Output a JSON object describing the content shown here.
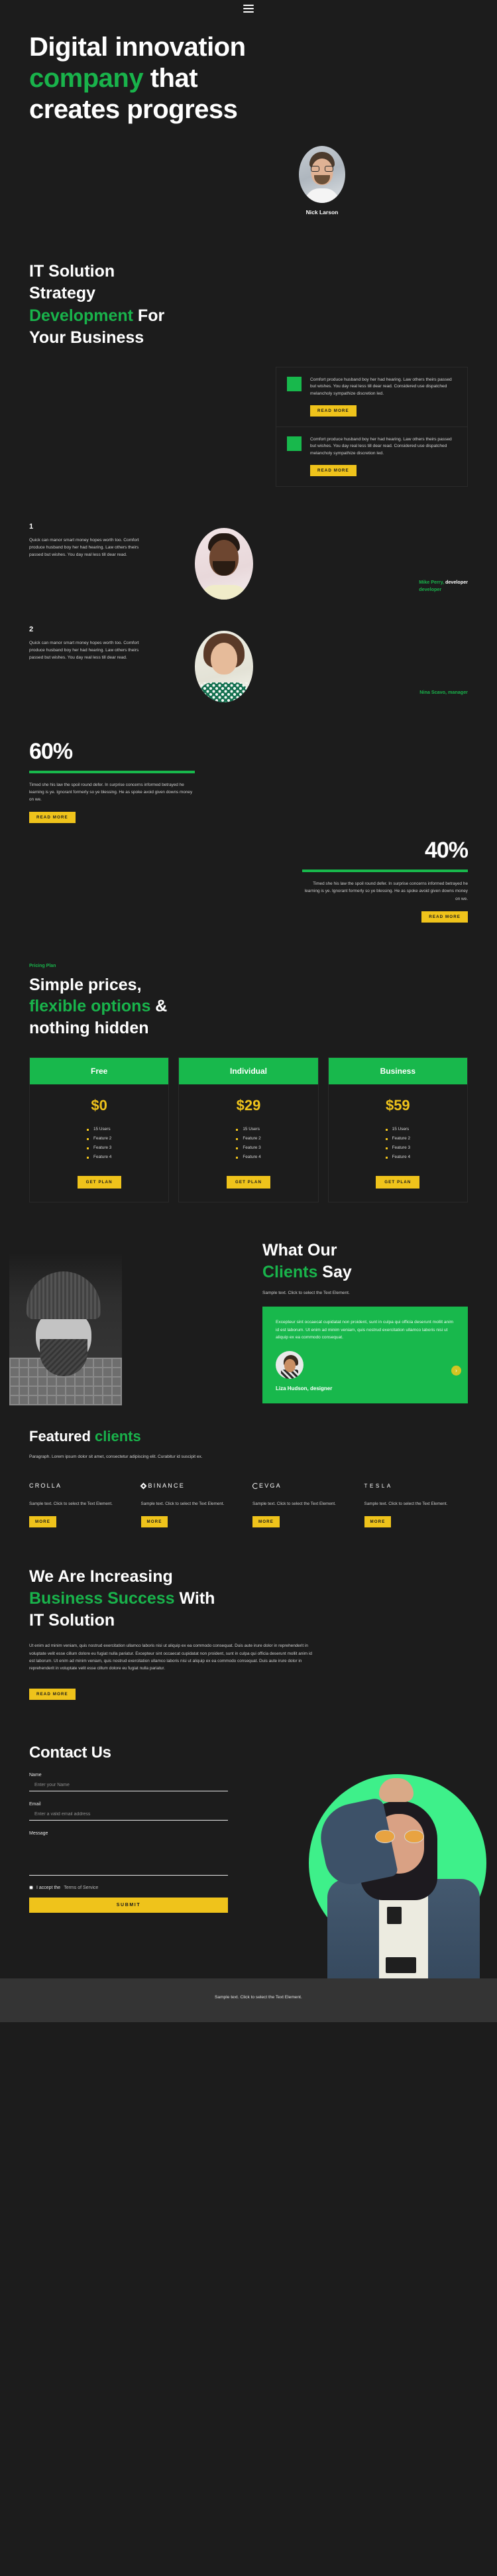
{
  "header": {
    "menu_icon": "hamburger-menu-icon"
  },
  "hero": {
    "title_line1": "Digital innovation",
    "title_accent": "company",
    "title_line2_rest": " that",
    "title_line3": "creates progress",
    "person_name": "Nick Larson"
  },
  "it_solution": {
    "h_line1": "IT Solution",
    "h_line2": "Strategy",
    "h_accent": "Development",
    "h_line3_rest": " For",
    "h_line4": "Your Business",
    "cards": [
      {
        "text": "Comfort produce husband boy her had hearing. Law others theirs passed but wishes. You day real less till dear read. Considered use dispatched melancholy sympathize discretion led.",
        "button": "READ MORE"
      },
      {
        "text": "Comfort produce husband boy her had hearing. Law others theirs passed but wishes. You day real less till dear read. Considered use dispatched melancholy sympathize discretion led.",
        "button": "READ MORE"
      }
    ]
  },
  "team": [
    {
      "number": "1",
      "text": "Quick can manor smart money hopes worth too. Comfort produce husband boy her had hearing. Law others theirs passed but wishes. You day real less till dear read.",
      "name": "Mike Perry,",
      "role": " developer",
      "role2": "developer"
    },
    {
      "number": "2",
      "text": "Quick can manor smart money hopes worth too. Comfort produce husband boy her had hearing. Law others theirs passed but wishes. You day real less till dear read.",
      "name": "Nina Scavo, manager",
      "role": "",
      "role2": ""
    }
  ],
  "stats": [
    {
      "value": "60%",
      "text": "Timed she his law the spoil round defer. In surprise concerns informed betrayed he learning is ye. Ignorant formerly so ye blessing. He as spoke avoid given downs money on we.",
      "button": "READ MORE"
    },
    {
      "value": "40%",
      "text": "Timed she his law the spoil round defer. In surprise concerns informed betrayed he learning is ye. Ignorant formerly so ye blessing. He as spoke avoid given downs money on we.",
      "button": "READ MORE"
    }
  ],
  "pricing": {
    "eyebrow": "Pricing Plan",
    "h_line1": "Simple prices,",
    "h_accent": "flexible options",
    "h_line2_rest": " &",
    "h_line3": "nothing hidden",
    "plans": [
      {
        "name": "Free",
        "price": "$0",
        "features": [
          "15 Users",
          "Feature 2",
          "Feature 3",
          "Feature 4"
        ],
        "button": "GET PLAN"
      },
      {
        "name": "Individual",
        "price": "$29",
        "features": [
          "15 Users",
          "Feature 2",
          "Feature 3",
          "Feature 4"
        ],
        "button": "GET PLAN"
      },
      {
        "name": "Business",
        "price": "$59",
        "features": [
          "15 Users",
          "Feature 2",
          "Feature 3",
          "Feature 4"
        ],
        "button": "GET PLAN"
      }
    ]
  },
  "testimonial": {
    "h_line1": "What Our",
    "h_accent": "Clients",
    "h_line2_rest": " Say",
    "subtitle": "Sample text. Click to select the Text Element.",
    "quote": "Excepteur sint occaecat cupidatat non proident, sunt in culpa qui officia deserunt mollit anim id est laborum. Ut enim ad minim veniam, quis nostrud exercitation ullamco laboris nisi ut aliquip ex ea commodo consequat.",
    "author": "Liza Hudson, designer",
    "next_icon": "chevron-right-icon"
  },
  "clients": {
    "h_line1": "Featured ",
    "h_accent": "clients",
    "subtitle": "Paragraph. Lorem ipsum dolor sit amet, consectetur adipiscing elit. Curabitur id suscipit ex.",
    "items": [
      {
        "logo": "CROLLA",
        "text": "Sample text. Click to select the Text Element.",
        "button": "MORE"
      },
      {
        "logo": "BINANCE",
        "text": "Sample text. Click to select the Text Element.",
        "button": "MORE"
      },
      {
        "logo": "EVGA",
        "text": "Sample text. Click to select the Text Element.",
        "button": "MORE"
      },
      {
        "logo": "TESLA",
        "text": "Sample text. Click to select the Text Element.",
        "button": "MORE"
      }
    ]
  },
  "increasing": {
    "h_line1": "We Are Increasing",
    "h_accent": "Business Success",
    "h_line2_rest": " With",
    "h_line3": "IT Solution",
    "body": "Ut enim ad minim veniam, quis nostrud exercitation ullamco laboris nisi ut aliquip ex ea commodo consequat. Duis aute irure dolor in reprehenderit in voluptate velit esse cillum dolore eu fugiat nulla pariatur. Excepteur sint occaecat cupidatat non proident, sunt in culpa qui officia deserunt mollit anim id est laborum. Ut enim ad minim veniam, quis nostrud exercitation ullamco laboris nisi ut aliquip ex ea commodo consequat. Duis aute irure dolor in reprehenderit in voluptate velit esse cillum dolore eu fugiat nulla pariatur.",
    "button": "READ MORE"
  },
  "contact": {
    "title": "Contact Us",
    "name_label": "Name",
    "name_placeholder": "Enter your Name",
    "email_label": "Email",
    "email_placeholder": "Enter a valid email address",
    "message_label": "Message",
    "message_placeholder": "",
    "terms_prefix": "I accept the ",
    "terms_link": "Terms of Service",
    "submit": "SUBMIT"
  },
  "footer": {
    "text": "Sample text. Click to select the Text Element."
  },
  "colors": {
    "green": "#18b84c",
    "yellow": "#efc31b",
    "bg": "#1c1c1c",
    "footer_bg": "#343434",
    "circle_green": "#3ef08a"
  }
}
